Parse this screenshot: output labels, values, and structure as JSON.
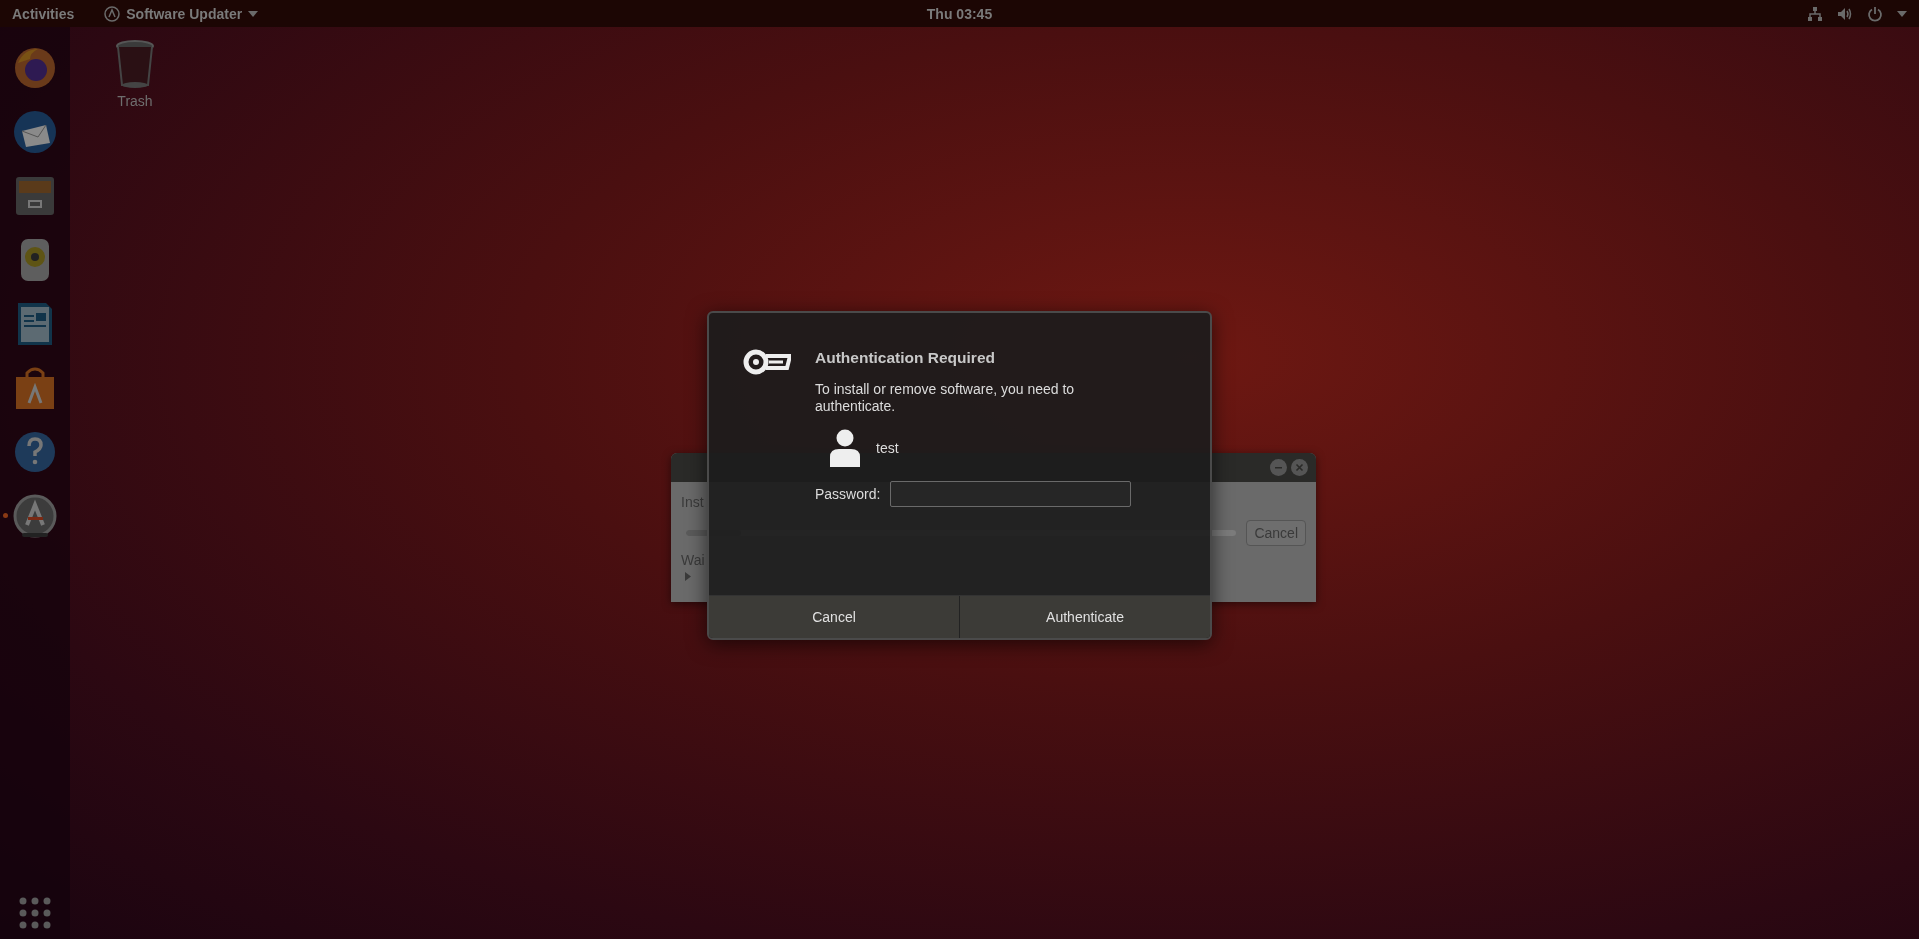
{
  "top_bar": {
    "activities": "Activities",
    "app_menu": "Software Updater",
    "clock": "Thu 03:45"
  },
  "dock": {
    "apps": [
      {
        "kind": "browser",
        "running": false
      },
      {
        "kind": "mail",
        "running": false
      },
      {
        "kind": "files",
        "running": false
      },
      {
        "kind": "speaker",
        "running": false
      },
      {
        "kind": "writer",
        "running": false
      },
      {
        "kind": "store",
        "running": false
      },
      {
        "kind": "help",
        "running": false
      },
      {
        "kind": "updater",
        "running": true
      }
    ]
  },
  "desktop_icons": [
    {
      "label": "Trash"
    }
  ],
  "updater_window": {
    "status": "Inst",
    "progress": {
      "level": 0.1
    },
    "detail": "Wai",
    "details_expander": {
      "expanded": false
    },
    "cancel_button": "Cancel"
  },
  "auth_dialog": {
    "title": "Authentication Required",
    "message": "To install or remove software, you need to authenticate.",
    "user": "test",
    "password_label": "Password:",
    "buttons": [
      "Cancel",
      "Authenticate"
    ]
  }
}
